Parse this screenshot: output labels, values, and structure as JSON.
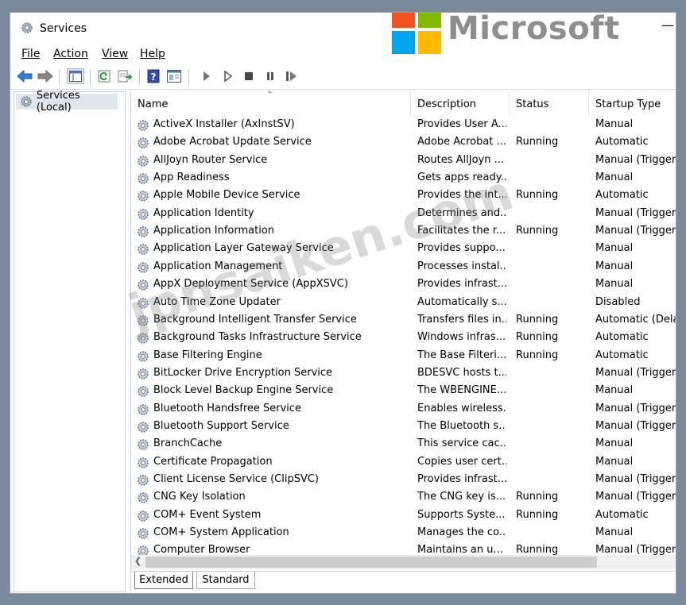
{
  "window": {
    "title": "Services"
  },
  "brand": {
    "name": "Microsoft",
    "colors": [
      "#f25022",
      "#7fba00",
      "#00a4ef",
      "#ffb900"
    ]
  },
  "menu": [
    "File",
    "Action",
    "View",
    "Help"
  ],
  "tree": {
    "root": "Services (Local)"
  },
  "columns": [
    "Name",
    "Description",
    "Status",
    "Startup Type"
  ],
  "services": [
    [
      "ActiveX Installer (AxInstSV)",
      "Provides User A...",
      "",
      "Manual"
    ],
    [
      "Adobe Acrobat Update Service",
      "Adobe Acrobat ...",
      "Running",
      "Automatic"
    ],
    [
      "AllJoyn Router Service",
      "Routes AllJoyn ...",
      "",
      "Manual (Trigger S"
    ],
    [
      "App Readiness",
      "Gets apps ready...",
      "",
      "Manual"
    ],
    [
      "Apple Mobile Device Service",
      "Provides the int...",
      "Running",
      "Automatic"
    ],
    [
      "Application Identity",
      "Determines and...",
      "",
      "Manual (Trigger S"
    ],
    [
      "Application Information",
      "Facilitates the r...",
      "Running",
      "Manual (Trigger S"
    ],
    [
      "Application Layer Gateway Service",
      "Provides suppo...",
      "",
      "Manual"
    ],
    [
      "Application Management",
      "Processes instal...",
      "",
      "Manual"
    ],
    [
      "AppX Deployment Service (AppXSVC)",
      "Provides infrast...",
      "",
      "Manual"
    ],
    [
      "Auto Time Zone Updater",
      "Automatically s...",
      "",
      "Disabled"
    ],
    [
      "Background Intelligent Transfer Service",
      "Transfers files in...",
      "Running",
      "Automatic (Delay"
    ],
    [
      "Background Tasks Infrastructure Service",
      "Windows infras...",
      "Running",
      "Automatic"
    ],
    [
      "Base Filtering Engine",
      "The Base Filteri...",
      "Running",
      "Automatic"
    ],
    [
      "BitLocker Drive Encryption Service",
      "BDESVC hosts t...",
      "",
      "Manual (Trigger S"
    ],
    [
      "Block Level Backup Engine Service",
      "The WBENGINE...",
      "",
      "Manual"
    ],
    [
      "Bluetooth Handsfree Service",
      "Enables wireless...",
      "",
      "Manual (Trigger S"
    ],
    [
      "Bluetooth Support Service",
      "The Bluetooth s...",
      "",
      "Manual (Trigger S"
    ],
    [
      "BranchCache",
      "This service cac...",
      "",
      "Manual"
    ],
    [
      "Certificate Propagation",
      "Copies user cert...",
      "",
      "Manual"
    ],
    [
      "Client License Service (ClipSVC)",
      "Provides infrast...",
      "",
      "Manual (Trigger S"
    ],
    [
      "CNG Key Isolation",
      "The CNG key is...",
      "Running",
      "Manual (Trigger S"
    ],
    [
      "COM+ Event System",
      "Supports Syste...",
      "Running",
      "Automatic"
    ],
    [
      "COM+ System Application",
      "Manages the co...",
      "",
      "Manual"
    ],
    [
      "Computer Browser",
      "Maintains an u...",
      "Running",
      "Manual (Trigger S"
    ]
  ],
  "tabs": [
    "Extended",
    "Standard"
  ],
  "watermark": "jpnsaiken.com",
  "icons": [
    "back-arrow-icon",
    "forward-arrow-icon",
    "console-tree-icon",
    "refresh-icon",
    "export-list-icon",
    "help-icon",
    "properties-icon",
    "start-service-icon",
    "start-alt-icon",
    "stop-service-icon",
    "pause-service-icon",
    "restart-service-icon",
    "gear-icon"
  ]
}
